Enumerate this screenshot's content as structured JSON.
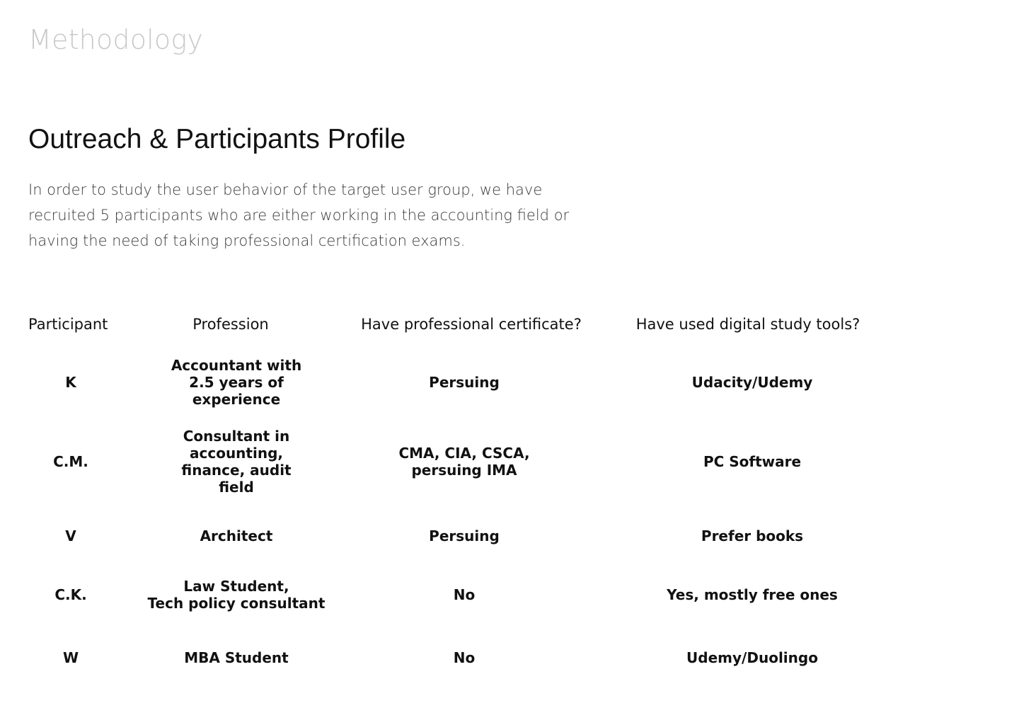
{
  "section_label": "Methodology",
  "heading": "Outreach & Participants Profile",
  "intro": "In order to study the user behavior of the target user group, we have recruited 5 participants who are either working in the accounting field or having the need of taking professional certification exams.",
  "table": {
    "headers": {
      "participant": "Participant",
      "profession": "Profession",
      "certificate": "Have professional certificate?",
      "tools": "Have used digital study tools?"
    },
    "rows": [
      {
        "participant": "K",
        "profession": "Accountant with\n2.5 years of\nexperience",
        "certificate": "Persuing",
        "tools": "Udacity/Udemy"
      },
      {
        "participant": "C.M.",
        "profession": "Consultant in\naccounting,\nfinance, audit\nfield",
        "certificate": "CMA, CIA, CSCA,\npersuing IMA",
        "tools": "PC Software"
      },
      {
        "participant": "V",
        "profession": "Architect",
        "certificate": "Persuing",
        "tools": "Prefer books"
      },
      {
        "participant": "C.K.",
        "profession": "Law Student,\nTech policy consultant",
        "certificate": "No",
        "tools": "Yes, mostly free ones"
      },
      {
        "participant": "W",
        "profession": "MBA Student",
        "certificate": "No",
        "tools": "Udemy/Duolingo"
      }
    ]
  }
}
